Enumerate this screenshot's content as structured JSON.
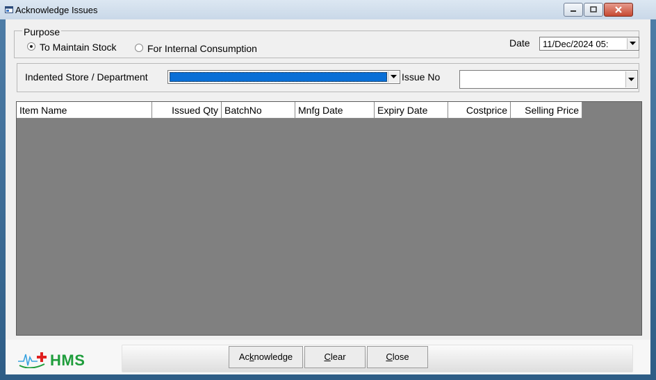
{
  "window": {
    "title": "Acknowledge Issues"
  },
  "purpose": {
    "legend": "Purpose",
    "options": [
      {
        "label": "To Maintain Stock",
        "checked": true
      },
      {
        "label": "For Internal Consumption",
        "checked": false
      }
    ]
  },
  "date": {
    "label": "Date",
    "value": "11/Dec/2024 05:"
  },
  "store": {
    "label": "Indented Store  / Department",
    "value": ""
  },
  "issue": {
    "label": "Issue No",
    "value": ""
  },
  "grid": {
    "columns": [
      "Item Name",
      "Issued Qty",
      "BatchNo",
      "Mnfg Date",
      "Expiry Date",
      "Costprice",
      "Selling Price"
    ],
    "rows": []
  },
  "footer": {
    "logo_text": "HMS",
    "buttons": [
      {
        "pre": "Ac",
        "ul": "k",
        "post": "nowledge"
      },
      {
        "pre": "",
        "ul": "C",
        "post": "lear"
      },
      {
        "pre": "",
        "ul": "C",
        "post": "lose"
      }
    ]
  },
  "colors": {
    "selection": "#0a6fd6",
    "grid_bg": "#808080",
    "logo_green": "#1f9d3c",
    "logo_red": "#e02020"
  }
}
